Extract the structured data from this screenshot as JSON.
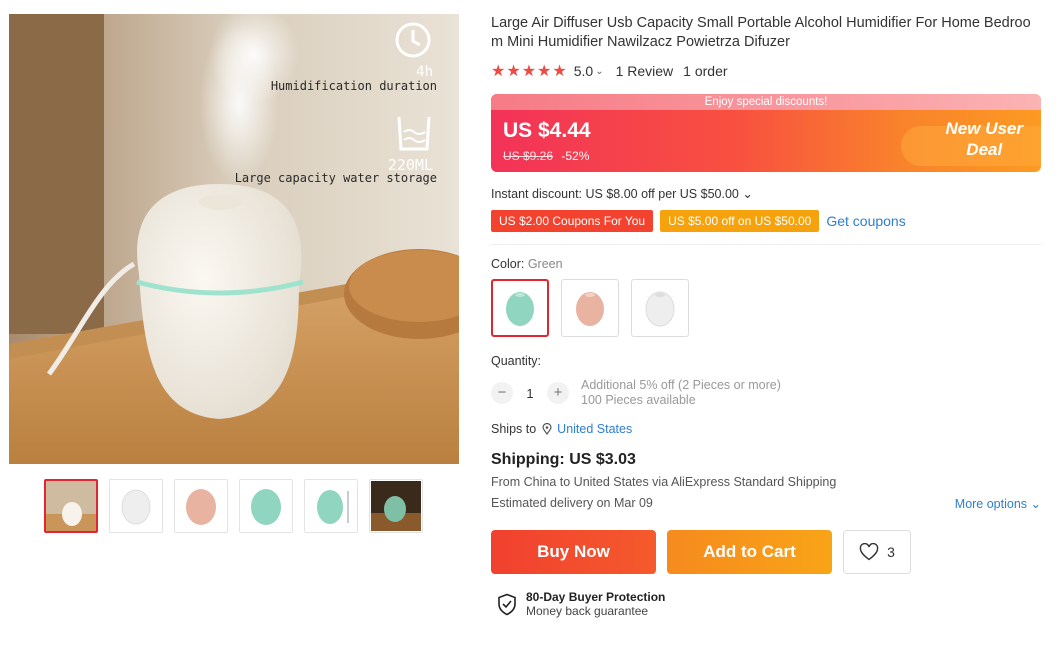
{
  "gallery": {
    "overlay": {
      "duration_value": "4h",
      "duration_label": "Humidification duration",
      "capacity_value": "220ML",
      "capacity_label": "Large capacity water storage"
    },
    "thumbnails": [
      "scene",
      "white",
      "pink",
      "green",
      "green-dimensions",
      "dark-scene"
    ],
    "active_thumbnail": 0
  },
  "product": {
    "title": "Large Air Diffuser Usb Capacity Small Portable Alcohol Humidifier For Home Bedroom Mini Humidifier Nawilzacz Powietrza Difuzer",
    "stars": "★★★★★",
    "rating": "5.0",
    "rating_chevron": "⌄",
    "reviews": "1 Review",
    "orders": "1 order"
  },
  "price": {
    "promo_strip": "Enjoy special discounts!",
    "current": "US $4.44",
    "original": "US $9.26",
    "discount": "-52%",
    "badge_line1": "New User",
    "badge_line2": "Deal"
  },
  "discounts": {
    "instant": "Instant discount: US $8.00 off per US $50.00 ⌄",
    "coupon1": "US $2.00 Coupons For You",
    "coupon2": "US $5.00 off on US $50.00",
    "get_coupons": "Get coupons"
  },
  "variants": {
    "label": "Color: ",
    "selected": "Green",
    "colors": [
      "#8fd5bf",
      "#e8b3a0",
      "#eeeeee"
    ]
  },
  "quantity": {
    "label": "Quantity:",
    "value": "1",
    "minus": "−",
    "plus": "+",
    "note1": "Additional 5% off (2 Pieces or more)",
    "note2": "100 Pieces available"
  },
  "shipping": {
    "ships_to_label": "Ships to",
    "country": "United States",
    "cost": "Shipping: US $3.03",
    "detail": "From China to United States via AliExpress Standard Shipping",
    "estimate": "Estimated delivery on Mar 09",
    "more_options": "More options ⌄"
  },
  "actions": {
    "buy_now": "Buy Now",
    "add_to_cart": "Add to Cart",
    "wishlist_count": "3"
  },
  "protection": {
    "title": "80-Day Buyer Protection",
    "subtitle": "Money back guarantee"
  }
}
